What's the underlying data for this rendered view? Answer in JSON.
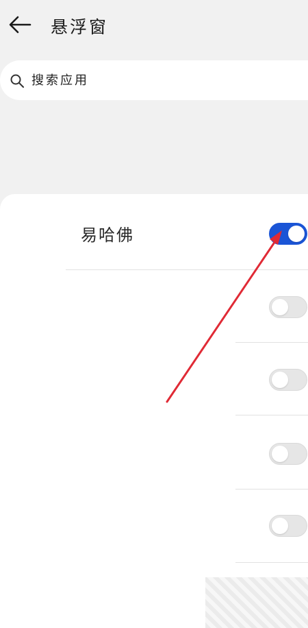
{
  "header": {
    "title": "悬浮窗",
    "back_icon": "arrow-left-icon"
  },
  "search": {
    "placeholder": "搜索应用",
    "value": "",
    "icon": "search-icon"
  },
  "apps": [
    {
      "label": "易哈佛",
      "enabled": true
    },
    {
      "label": "",
      "enabled": false
    },
    {
      "label": "",
      "enabled": false
    },
    {
      "label": "",
      "enabled": false
    },
    {
      "label": "",
      "enabled": false
    }
  ],
  "colors": {
    "toggle_on": "#1b55d6",
    "toggle_off": "#e6e6e6",
    "annotation_arrow": "#e02a35",
    "background": "#f1f1f1"
  }
}
